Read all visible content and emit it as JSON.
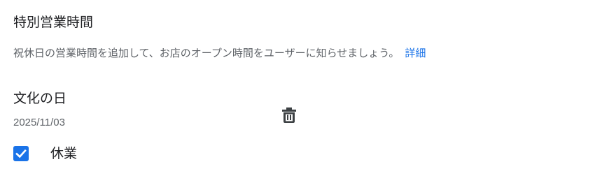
{
  "section": {
    "title": "特別営業時間",
    "description": "祝休日の営業時間を追加して、お店のオープン時間をユーザーに知らせましょう。",
    "details_link": "詳細"
  },
  "holiday": {
    "name": "文化の日",
    "date": "2025/11/03",
    "closed_label": "休業",
    "closed_checked": true,
    "delete_icon": "trash-icon"
  },
  "colors": {
    "accent": "#1a73e8",
    "text_primary": "#202124",
    "text_secondary": "#5f6368"
  }
}
